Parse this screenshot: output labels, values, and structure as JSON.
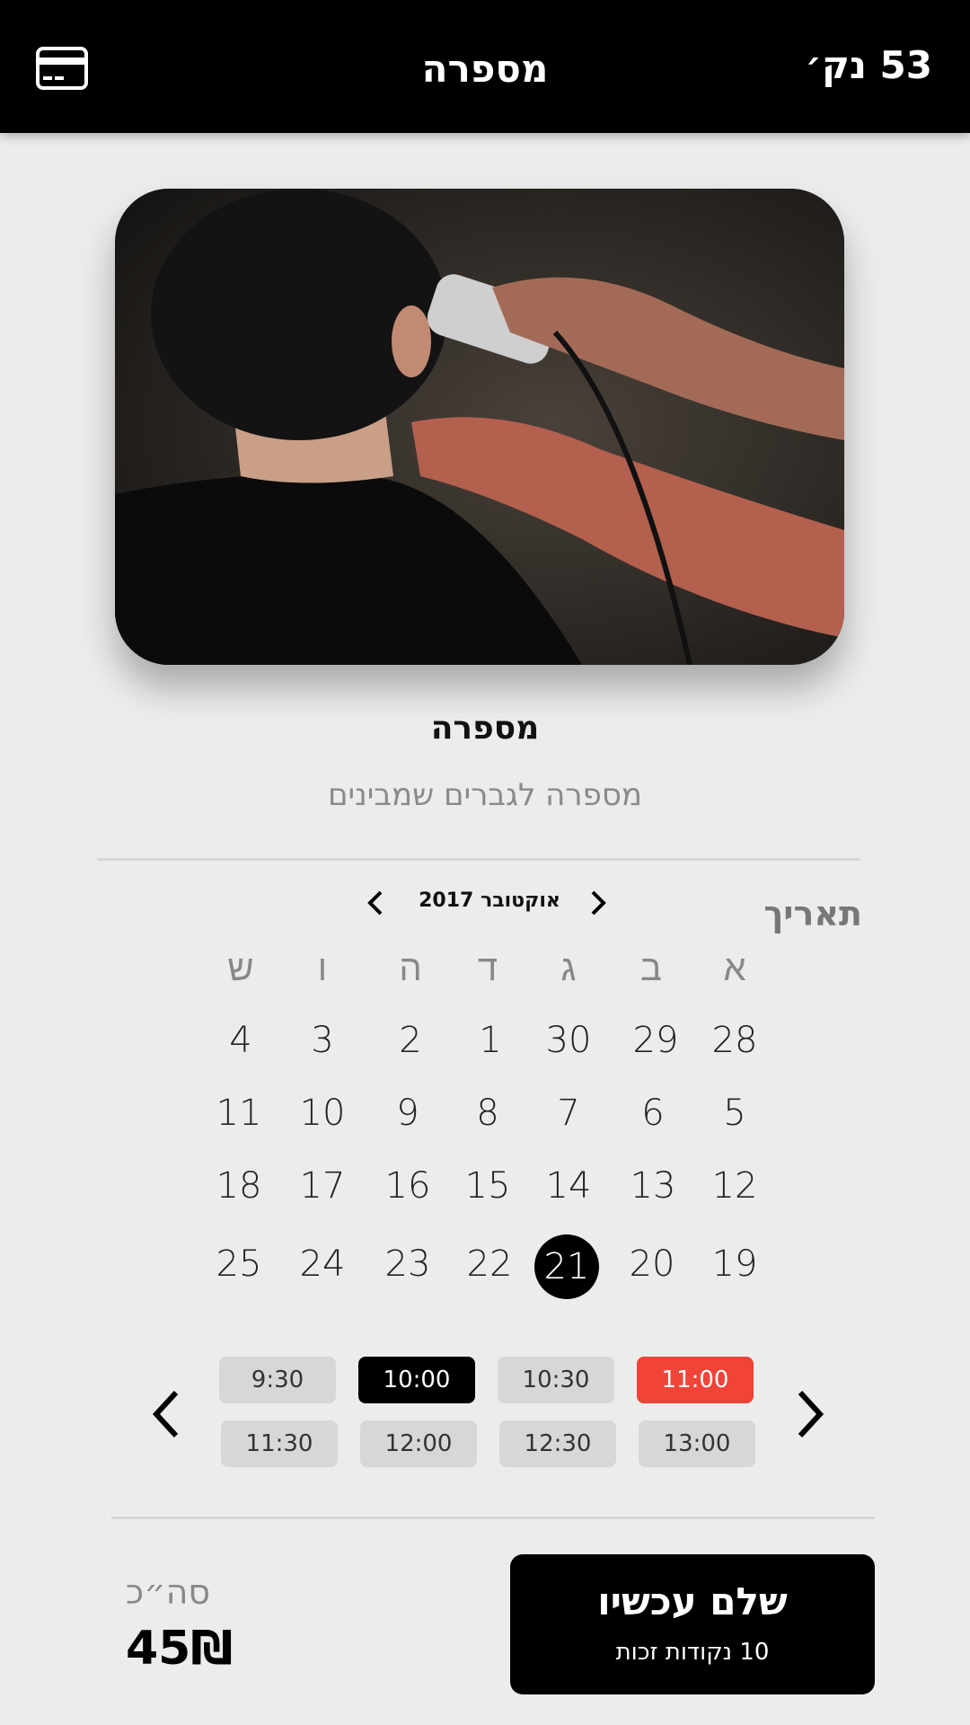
{
  "header": {
    "title": "מספרה",
    "points": "53 נק׳",
    "card_icon": "credit-card-icon"
  },
  "shop": {
    "name": "מספרה",
    "description": "מספרה לגברים שמבינים"
  },
  "calendar": {
    "label": "תאריך",
    "month": "אוקטובר 2017",
    "weekdays": [
      "א",
      "ב",
      "ג",
      "ד",
      "ה",
      "ו",
      "ש"
    ],
    "weeks": [
      [
        "28",
        "29",
        "30",
        "1",
        "2",
        "3",
        "4"
      ],
      [
        "5",
        "6",
        "7",
        "8",
        "9",
        "10",
        "11"
      ],
      [
        "12",
        "13",
        "14",
        "15",
        "16",
        "17",
        "18"
      ],
      [
        "19",
        "20",
        "21",
        "22",
        "23",
        "24",
        "25"
      ]
    ],
    "selected": "21"
  },
  "time_slots": {
    "row1": [
      "11:00",
      "10:30",
      "10:00",
      "9:30"
    ],
    "row2": [
      "13:00",
      "12:30",
      "12:00",
      "11:30"
    ],
    "selected": "10:00",
    "highlighted": "11:00"
  },
  "footer": {
    "total_label": "סה״כ",
    "total_value": "45₪",
    "pay_label": "שלם עכשיו",
    "pay_sub": "10 נקודות זכות"
  },
  "colors": {
    "accent": "#000000",
    "highlight": "#f04438",
    "background": "#ececec"
  }
}
